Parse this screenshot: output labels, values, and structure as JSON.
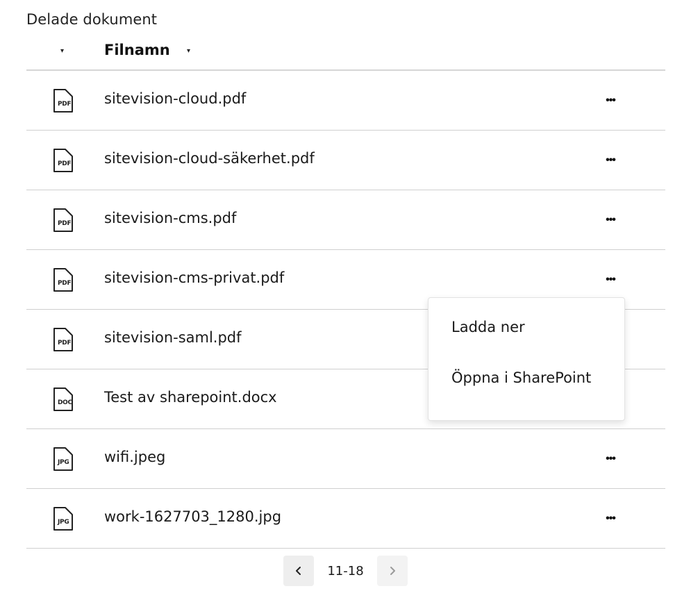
{
  "section": {
    "title": "Delade dokument"
  },
  "table": {
    "header": {
      "name_label": "Filnamn",
      "sort_caret": "▾"
    },
    "rows": [
      {
        "icon": "pdf-file-icon",
        "ext": "PDF",
        "name": "sitevision-cloud.pdf",
        "more": "•••"
      },
      {
        "icon": "pdf-file-icon",
        "ext": "PDF",
        "name": "sitevision-cloud-säkerhet.pdf",
        "more": "•••"
      },
      {
        "icon": "pdf-file-icon",
        "ext": "PDF",
        "name": "sitevision-cms.pdf",
        "more": "•••"
      },
      {
        "icon": "pdf-file-icon",
        "ext": "PDF",
        "name": "sitevision-cms-privat.pdf",
        "more": "•••"
      },
      {
        "icon": "pdf-file-icon",
        "ext": "PDF",
        "name": "sitevision-saml.pdf",
        "more": "•••"
      },
      {
        "icon": "doc-file-icon",
        "ext": "DOC",
        "name": "Test av sharepoint.docx",
        "more": "•••"
      },
      {
        "icon": "jpg-file-icon",
        "ext": "JPG",
        "name": "wifi.jpeg",
        "more": "•••"
      },
      {
        "icon": "jpg-file-icon",
        "ext": "JPG",
        "name": "work-1627703_1280.jpg",
        "more": "•••"
      }
    ]
  },
  "context_menu": {
    "items": [
      {
        "label": "Ladda ner"
      },
      {
        "label": "Öppna i SharePoint"
      }
    ]
  },
  "pagination": {
    "range": "11-18",
    "prev_icon": "chevron-left-icon",
    "next_icon": "chevron-right-icon"
  }
}
